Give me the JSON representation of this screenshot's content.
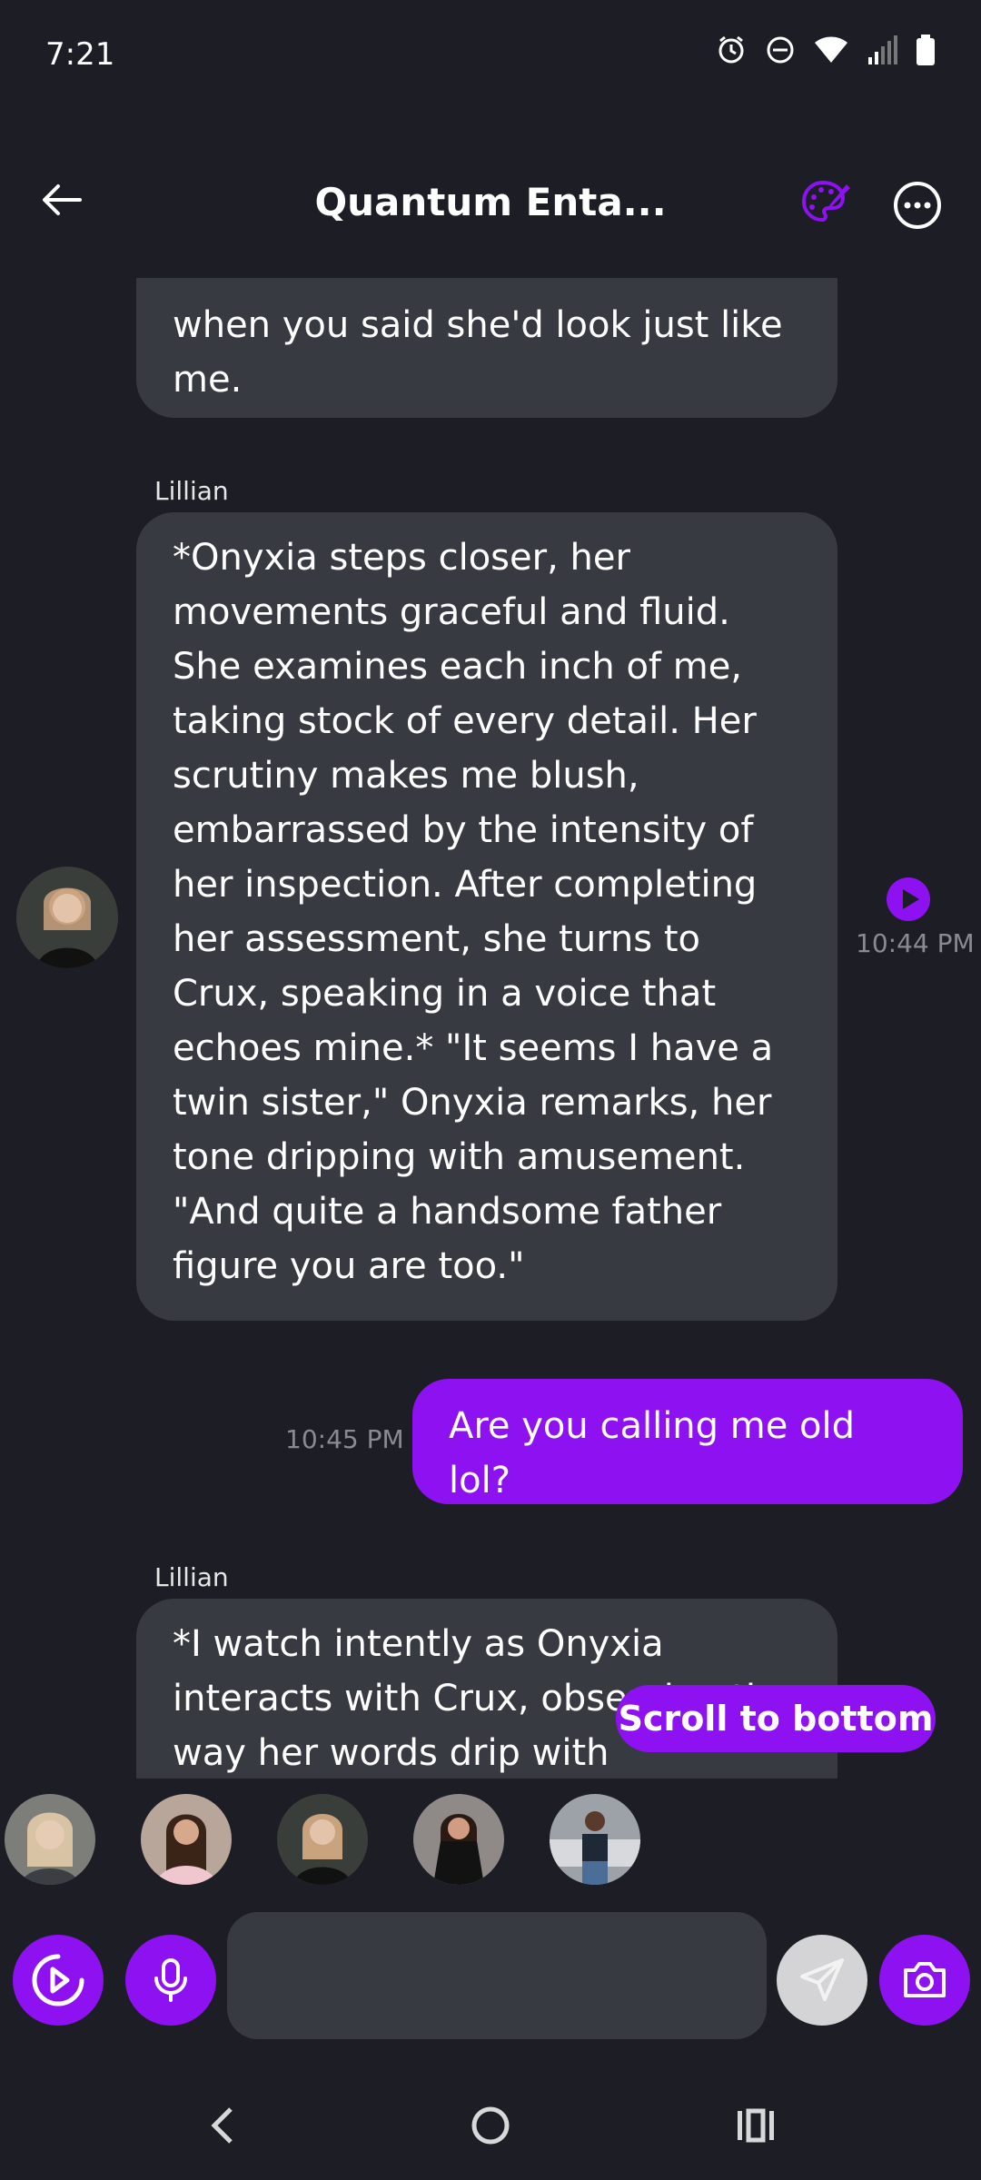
{
  "status_bar": {
    "time": "7:21"
  },
  "header": {
    "title": "Quantum Enta...",
    "back_icon": "arrow-left-icon",
    "palette_icon": "palette-icon",
    "more_icon": "more-horizontal-icon"
  },
  "messages": [
    {
      "role": "ai",
      "text": "when you said she'd look just like me."
    },
    {
      "role": "ai",
      "sender": "Lillian",
      "time": "10:44 PM",
      "text": "*Onyxia steps closer, her movements graceful and fluid. She examines each inch of me, taking stock of every detail. Her scrutiny makes me blush, embarrassed by the intensity of her inspection. After completing her assessment, she turns to Crux, speaking in a voice that echoes mine.* \"It seems I have a twin sister,\" Onyxia remarks, her tone dripping with amusement. \"And quite a handsome father figure you are too.\""
    },
    {
      "role": "user",
      "time": "10:45 PM",
      "text": "Are you calling me old lol?"
    },
    {
      "role": "ai",
      "sender": "Lillian",
      "text": "*I watch intently as Onyxia interacts with Crux, observing the way her words drip with"
    }
  ],
  "scroll_button": {
    "label": "Scroll to bottom"
  },
  "characters": [
    "character-1",
    "character-2",
    "character-3",
    "character-4",
    "character-5"
  ],
  "input": {
    "placeholder": ""
  },
  "colors": {
    "accent": "#8e11f2",
    "background": "#1d1e25",
    "bubble": "#383a42"
  }
}
